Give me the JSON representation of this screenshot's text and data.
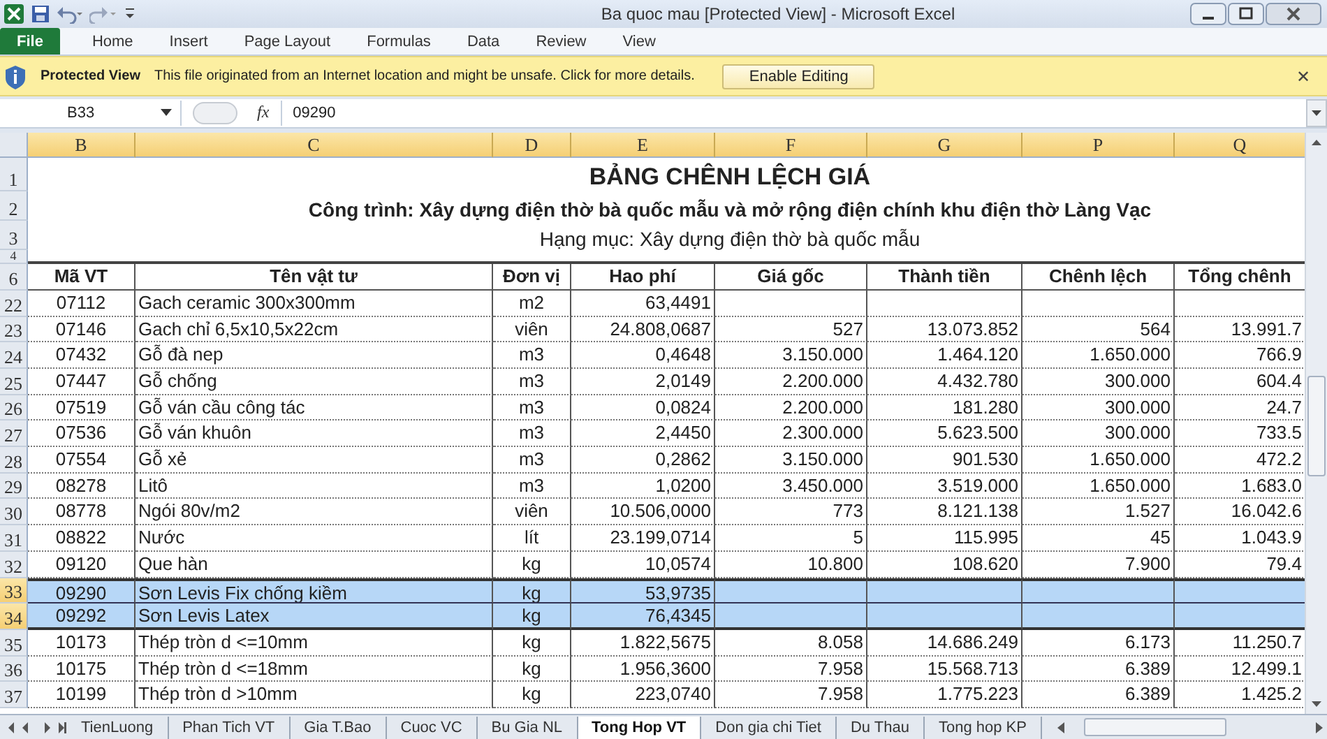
{
  "window": {
    "title": "Ba quoc mau  [Protected View]  -  Microsoft Excel"
  },
  "ribbon_tabs": [
    {
      "label": "File",
      "kind": "file",
      "selected": false
    },
    {
      "label": "Home",
      "kind": "tab",
      "selected": false
    },
    {
      "label": "Insert",
      "kind": "tab",
      "selected": false
    },
    {
      "label": "Page Layout",
      "kind": "tab",
      "selected": false
    },
    {
      "label": "Formulas",
      "kind": "tab",
      "selected": false
    },
    {
      "label": "Data",
      "kind": "tab",
      "selected": false
    },
    {
      "label": "Review",
      "kind": "tab",
      "selected": false
    },
    {
      "label": "View",
      "kind": "tab",
      "selected": false
    }
  ],
  "protected_bar": {
    "title": "Protected View",
    "message": "This file originated from an Internet location and might be unsafe. Click for more details.",
    "button": "Enable Editing",
    "close": "✕"
  },
  "formula_bar": {
    "name_box": "B33",
    "fx": "fx",
    "value": "09290"
  },
  "columns": [
    {
      "letter": "B"
    },
    {
      "letter": "C"
    },
    {
      "letter": "D"
    },
    {
      "letter": "E"
    },
    {
      "letter": "F"
    },
    {
      "letter": "G"
    },
    {
      "letter": "P"
    },
    {
      "letter": "Q"
    }
  ],
  "title_rows": [
    {
      "row_number": "1",
      "kind": "title",
      "text": "BẢNG CHÊNH LỆCH GIÁ"
    },
    {
      "row_number": "2",
      "kind": "subtitle",
      "text": "Công trình: Xây dựng điện thờ bà quốc mẫu và mở rộng điện chính khu điện thờ Làng Vạc"
    },
    {
      "row_number": "3",
      "kind": "caption",
      "text": "Hạng mục: Xây dựng điện thờ bà quốc mẫu"
    },
    {
      "row_number": "4",
      "kind": "spacer",
      "text": ""
    }
  ],
  "header_row": {
    "row_number": "6",
    "cells": [
      "Mã VT",
      "Tên vật tư",
      "Đơn vị",
      "Hao phí",
      "Giá gốc",
      "Thành tiền",
      "Chênh lệch",
      "Tổng chênh"
    ]
  },
  "rows": [
    {
      "row_number": "22",
      "selected": false,
      "cells": [
        "07112",
        "Gach ceramic 300x300mm",
        "m2",
        "63,4491",
        "",
        "",
        "",
        ""
      ]
    },
    {
      "row_number": "23",
      "selected": false,
      "cells": [
        "07146",
        "Gach chỉ 6,5x10,5x22cm",
        "viên",
        "24.808,0687",
        "527",
        "13.073.852",
        "564",
        "13.991.7"
      ]
    },
    {
      "row_number": "24",
      "selected": false,
      "cells": [
        "07432",
        "Gỗ đà nep",
        "m3",
        "0,4648",
        "3.150.000",
        "1.464.120",
        "1.650.000",
        "766.9"
      ]
    },
    {
      "row_number": "25",
      "selected": false,
      "cells": [
        "07447",
        "Gỗ chống",
        "m3",
        "2,0149",
        "2.200.000",
        "4.432.780",
        "300.000",
        "604.4"
      ]
    },
    {
      "row_number": "26",
      "selected": false,
      "cells": [
        "07519",
        "Gỗ ván cầu công tác",
        "m3",
        "0,0824",
        "2.200.000",
        "181.280",
        "300.000",
        "24.7"
      ]
    },
    {
      "row_number": "27",
      "selected": false,
      "cells": [
        "07536",
        "Gỗ ván khuôn",
        "m3",
        "2,4450",
        "2.300.000",
        "5.623.500",
        "300.000",
        "733.5"
      ]
    },
    {
      "row_number": "28",
      "selected": false,
      "cells": [
        "07554",
        "Gỗ xẻ",
        "m3",
        "0,2862",
        "3.150.000",
        "901.530",
        "1.650.000",
        "472.2"
      ]
    },
    {
      "row_number": "29",
      "selected": false,
      "cells": [
        "08278",
        "Litô",
        "m3",
        "1,0200",
        "3.450.000",
        "3.519.000",
        "1.650.000",
        "1.683.0"
      ]
    },
    {
      "row_number": "30",
      "selected": false,
      "cells": [
        "08778",
        "Ngói 80v/m2",
        "viên",
        "10.506,0000",
        "773",
        "8.121.138",
        "1.527",
        "16.042.6"
      ]
    },
    {
      "row_number": "31",
      "selected": false,
      "cells": [
        "08822",
        "Nước",
        "lít",
        "23.199,0714",
        "5",
        "115.995",
        "45",
        "1.043.9"
      ]
    },
    {
      "row_number": "32",
      "selected": false,
      "cells": [
        "09120",
        "Que hàn",
        "kg",
        "10,0574",
        "10.800",
        "108.620",
        "7.900",
        "79.4"
      ]
    },
    {
      "row_number": "33",
      "selected": true,
      "cells": [
        "09290",
        "Sơn Levis Fix chống kiềm",
        "kg",
        "53,9735",
        "",
        "",
        "",
        ""
      ]
    },
    {
      "row_number": "34",
      "selected": true,
      "cells": [
        "09292",
        "Sơn Levis Latex",
        "kg",
        "76,4345",
        "",
        "",
        "",
        ""
      ]
    },
    {
      "row_number": "35",
      "selected": false,
      "cells": [
        "10173",
        "Thép tròn d <=10mm",
        "kg",
        "1.822,5675",
        "8.058",
        "14.686.249",
        "6.173",
        "11.250.7"
      ]
    },
    {
      "row_number": "36",
      "selected": false,
      "cells": [
        "10175",
        "Thép tròn d <=18mm",
        "kg",
        "1.956,3600",
        "7.958",
        "15.568.713",
        "6.389",
        "12.499.1"
      ]
    },
    {
      "row_number": "37",
      "selected": false,
      "cells": [
        "10199",
        "Thép tròn d >10mm",
        "kg",
        "223,0740",
        "7.958",
        "1.775.223",
        "6.389",
        "1.425.2"
      ]
    }
  ],
  "sheet_tabs": [
    {
      "label": "TienLuong",
      "selected": false
    },
    {
      "label": "Phan Tich VT",
      "selected": false
    },
    {
      "label": "Gia T.Bao",
      "selected": false
    },
    {
      "label": "Cuoc VC",
      "selected": false
    },
    {
      "label": "Bu Gia NL",
      "selected": false
    },
    {
      "label": "Tong Hop VT",
      "selected": true
    },
    {
      "label": "Don gia chi Tiet",
      "selected": false
    },
    {
      "label": "Du Thau",
      "selected": false
    },
    {
      "label": "Tong hop KP",
      "selected": false
    }
  ]
}
